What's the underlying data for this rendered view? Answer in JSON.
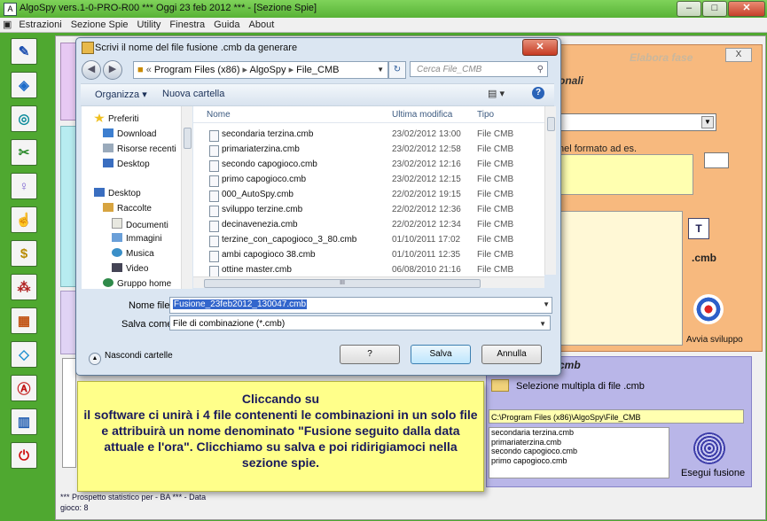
{
  "app": {
    "title": "AlgoSpy vers.1-0-PRO-R00  ***  Oggi 23 feb 2012  ***  - [Sezione Spie]",
    "menu": [
      "Estrazioni",
      "Sezione Spie",
      "Utility",
      "Finestra",
      "Guida",
      "About"
    ],
    "toolbar_icons": [
      "pencil-icon",
      "box-icon",
      "circle-arrow-icon",
      "tools-icon",
      "lightbulb-icon",
      "hand-icon",
      "dollar-icon",
      "network-icon",
      "calendar-icon",
      "diamond-icon",
      "letter-a-icon",
      "book-icon",
      "power-icon"
    ]
  },
  "right_panel": {
    "title": "Elabora fase",
    "close_label": "X",
    "section_title": "onali",
    "hint": "nel formato ad es.",
    "tt_label": "T",
    "cmb_label": ".cmb",
    "avvia_label": "Avvia sviluppo"
  },
  "lower_panel": {
    "title": "cmb",
    "multi_label": "Selezione multipla di file .cmb",
    "path": "C:\\Program Files (x86)\\AlgoSpy\\File_CMB",
    "files": [
      "secondaria terzina.cmb",
      "primariaterzina.cmb",
      "secondo capogioco.cmb",
      "primo capogioco.cmb"
    ],
    "esegui_label": "Esegui fusione"
  },
  "status": {
    "line1": "*** Prospetto statistico per  - BA ***  - Data",
    "line2": "gioco: 8"
  },
  "dialog": {
    "title": "Scrivi il nome del file fusione .cmb da generare",
    "close": "✕",
    "breadcrumb": [
      "Program Files (x86)",
      "AlgoSpy",
      "File_CMB"
    ],
    "search_placeholder": "Cerca File_CMB",
    "organizza": "Organizza ▾",
    "nuova_cartella": "Nuova cartella",
    "nav": {
      "preferiti": "Preferiti",
      "download": "Download",
      "risorse": "Risorse recenti",
      "desktop1": "Desktop",
      "desktop2": "Desktop",
      "raccolte": "Raccolte",
      "documenti": "Documenti",
      "immagini": "Immagini",
      "musica": "Musica",
      "video": "Video",
      "gruppo": "Gruppo home"
    },
    "columns": {
      "name": "Nome",
      "modified": "Ultima modifica",
      "type": "Tipo"
    },
    "files": [
      {
        "name": "secondaria terzina.cmb",
        "date": "23/02/2012 13:00",
        "type": "File CMB"
      },
      {
        "name": "primariaterzina.cmb",
        "date": "23/02/2012 12:58",
        "type": "File CMB"
      },
      {
        "name": "secondo capogioco.cmb",
        "date": "23/02/2012 12:16",
        "type": "File CMB"
      },
      {
        "name": "primo capogioco.cmb",
        "date": "23/02/2012 12:15",
        "type": "File CMB"
      },
      {
        "name": "000_AutoSpy.cmb",
        "date": "22/02/2012 19:15",
        "type": "File CMB"
      },
      {
        "name": "sviluppo terzine.cmb",
        "date": "22/02/2012 12:36",
        "type": "File CMB"
      },
      {
        "name": "decinavenezia.cmb",
        "date": "22/02/2012 12:34",
        "type": "File CMB"
      },
      {
        "name": "terzine_con_capogioco_3_80.cmb",
        "date": "01/10/2011 17:02",
        "type": "File CMB"
      },
      {
        "name": "ambi capogioco 38.cmb",
        "date": "01/10/2011 12:35",
        "type": "File CMB"
      },
      {
        "name": "ottine master.cmb",
        "date": "06/08/2010 21:16",
        "type": "File CMB"
      }
    ],
    "filename_label": "Nome file:",
    "filename_value": "Fusione_23feb2012_130047.cmb",
    "savetype_label": "Salva come:",
    "savetype_value": "File di combinazione (*.cmb)",
    "hide_folders": "Nascondi cartelle",
    "btn_help": "?",
    "btn_save": "Salva",
    "btn_cancel": "Annulla"
  },
  "caption": {
    "text": "Cliccando su\nil software ci unirà i 4 file contenenti le combinazioni in un solo file e attribuirà un nome denominato \"Fusione seguito dalla data attuale e l'ora\". Clicchiamo su salva e poi ridirigiamoci nella sezione spie."
  },
  "colors": {
    "accent_green": "#4fa830",
    "caption_bg": "#ffff8a",
    "panel_orange": "#f7b97e",
    "panel_lavender": "#b9b6e8"
  }
}
